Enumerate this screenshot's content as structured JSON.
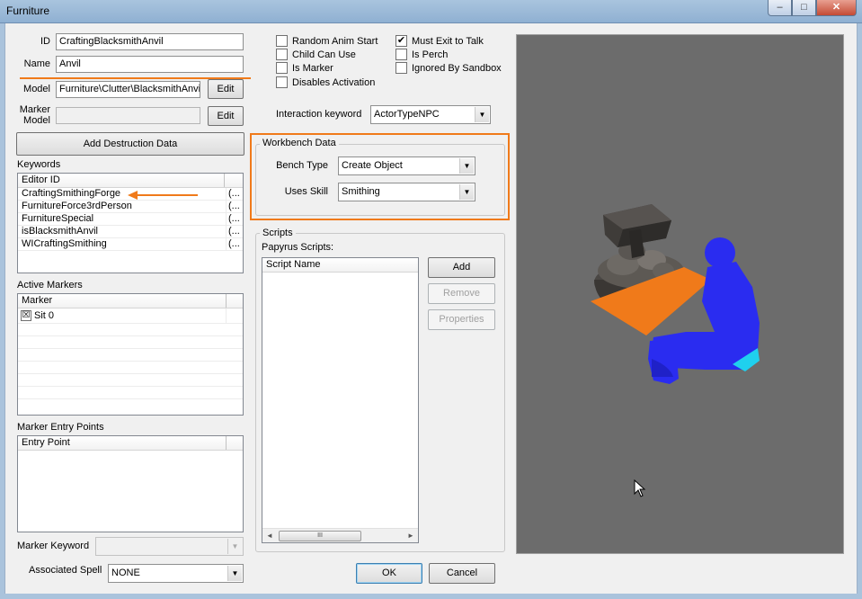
{
  "window": {
    "title": "Furniture",
    "buttons": {
      "minimize": "–",
      "maximize": "□",
      "close": "✕"
    }
  },
  "fields": {
    "id_label": "ID",
    "id_value": "CraftingBlacksmithAnvil",
    "name_label": "Name",
    "name_value": "Anvil",
    "model_label": "Model",
    "model_value": "Furniture\\Clutter\\BlacksmithAnvil",
    "marker_model_label": "Marker\nModel",
    "marker_model_value": "",
    "edit_label": "Edit"
  },
  "flags": [
    {
      "label": "Random Anim Start",
      "checked": false
    },
    {
      "label": "Child Can Use",
      "checked": false
    },
    {
      "label": "Is Marker",
      "checked": false
    },
    {
      "label": "Disables Activation",
      "checked": false
    },
    {
      "label": "Must Exit to Talk",
      "checked": true
    },
    {
      "label": "Is Perch",
      "checked": false
    },
    {
      "label": "Ignored By Sandbox",
      "checked": false
    }
  ],
  "interaction_keyword": {
    "label": "Interaction keyword",
    "value": "ActorTypeNPC"
  },
  "destruction": {
    "button_label": "Add Destruction Data"
  },
  "keywords": {
    "label": "Keywords",
    "column": "Editor ID",
    "rows": [
      {
        "id": "CraftingSmithingForge",
        "extra": "(..."
      },
      {
        "id": "FurnitureForce3rdPerson",
        "extra": "(..."
      },
      {
        "id": "FurnitureSpecial",
        "extra": "(..."
      },
      {
        "id": "isBlacksmithAnvil",
        "extra": "(..."
      },
      {
        "id": "WICraftingSmithing",
        "extra": "(..."
      }
    ]
  },
  "workbench": {
    "title": "Workbench Data",
    "bench_type_label": "Bench Type",
    "bench_type_value": "Create Object",
    "uses_skill_label": "Uses Skill",
    "uses_skill_value": "Smithing"
  },
  "active_markers": {
    "label": "Active Markers",
    "column": "Marker",
    "rows": [
      {
        "label": "Sit 0",
        "checked": true
      }
    ]
  },
  "marker_entry": {
    "label": "Marker Entry Points",
    "column": "Entry Point"
  },
  "marker_keyword": {
    "label": "Marker Keyword",
    "value": ""
  },
  "associated_spell": {
    "label": "Associated Spell",
    "value": "NONE"
  },
  "scripts": {
    "title": "Scripts",
    "papyrus_label": "Papyrus Scripts:",
    "column": "Script Name",
    "add_label": "Add",
    "remove_label": "Remove",
    "properties_label": "Properties",
    "scroll_grip": "III"
  },
  "dialog": {
    "ok_label": "OK",
    "cancel_label": "Cancel"
  },
  "colors": {
    "highlight": "#f07a1a",
    "viewport_bg": "#6c6c6c",
    "npc_blue": "#2a2cf0",
    "marker_cyan": "#1fd0ee"
  }
}
